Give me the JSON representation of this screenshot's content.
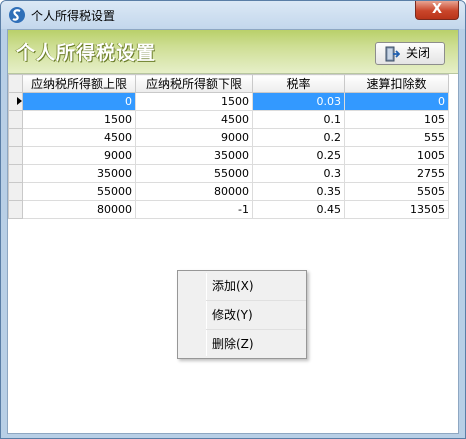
{
  "window": {
    "title": "个人所得税设置",
    "close_glyph": "X"
  },
  "header": {
    "title": "个人所得税设置",
    "close_label": "关闭"
  },
  "grid": {
    "columns": [
      "应纳税所得额上限",
      "应纳税所得额下限",
      "税率",
      "速算扣除数"
    ],
    "rows": [
      [
        "0",
        "1500",
        "0.03",
        "0"
      ],
      [
        "1500",
        "4500",
        "0.1",
        "105"
      ],
      [
        "4500",
        "9000",
        "0.2",
        "555"
      ],
      [
        "9000",
        "35000",
        "0.25",
        "1005"
      ],
      [
        "35000",
        "55000",
        "0.3",
        "2755"
      ],
      [
        "55000",
        "80000",
        "0.35",
        "5505"
      ],
      [
        "80000",
        "-1",
        "0.45",
        "13505"
      ]
    ]
  },
  "context_menu": {
    "items": [
      "添加(X)",
      "修改(Y)",
      "删除(Z)"
    ]
  },
  "colors": {
    "selection": "#3399ff",
    "header_green": "#b9d06a",
    "close_red": "#c9452a"
  }
}
